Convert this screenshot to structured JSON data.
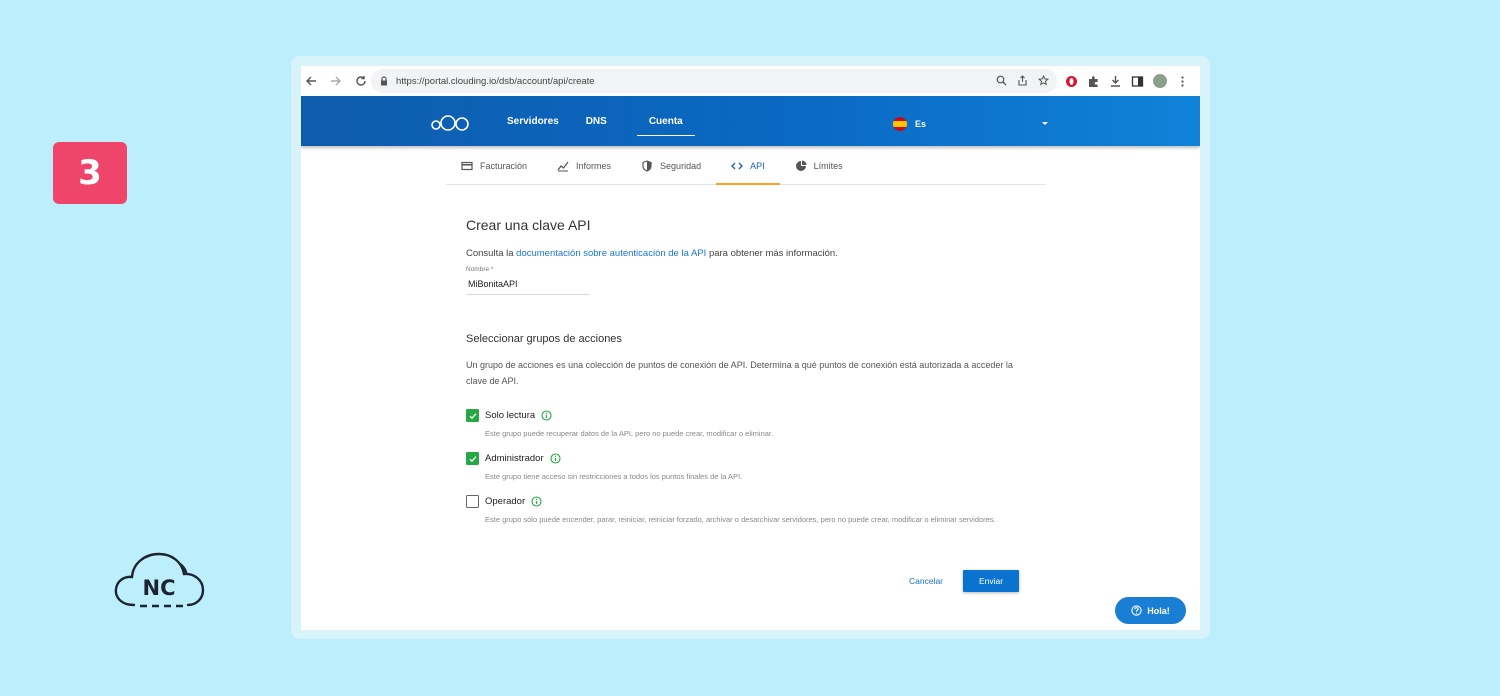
{
  "step": {
    "number": "3"
  },
  "browser": {
    "url": "https://portal.clouding.io/dsb/account/api/create"
  },
  "header": {
    "nav": [
      "Servidores",
      "DNS",
      "Cuenta"
    ],
    "active": "Cuenta",
    "language": "Es"
  },
  "subnav": {
    "tabs": [
      "Facturación",
      "Informes",
      "Seguridad",
      "API",
      "Límites"
    ],
    "active": "API"
  },
  "form": {
    "title": "Crear una clave API",
    "intro_prefix": "Consulta la ",
    "intro_link": "documentación sobre autenticación de la API",
    "intro_suffix": " para obtener más información.",
    "name_label": "Nombre *",
    "name_value": "MiBonitaAPI"
  },
  "groups": {
    "title": "Seleccionar grupos de acciones",
    "description": "Un grupo de acciones es una colección de puntos de conexión de API. Determina a qué puntos de conexión está autorizada a acceder la clave de API.",
    "options": [
      {
        "name": "Solo lectura",
        "checked": true,
        "desc": "Este grupo puede recuperar datos de la API, pero no puede crear, modificar o eliminar."
      },
      {
        "name": "Administrador",
        "checked": true,
        "desc": "Este grupo tiene acceso sin restricciones a todos los puntos finales de la API."
      },
      {
        "name": "Operador",
        "checked": false,
        "desc": "Este grupo sólo puede encender, parar, reiniciar, reiniciar forzado, archivar o desarchivar servidores, pero no puede crear, modificar o eliminar servidores."
      }
    ]
  },
  "actions": {
    "cancel": "Cancelar",
    "submit": "Enviar"
  },
  "chat": {
    "label": "Hola!"
  },
  "brand": {
    "logo_text": "NC"
  },
  "colors": {
    "primary": "#0a69c3",
    "badge": "#f0456b",
    "check": "#27a844",
    "tab_accent": "#f5a623"
  }
}
